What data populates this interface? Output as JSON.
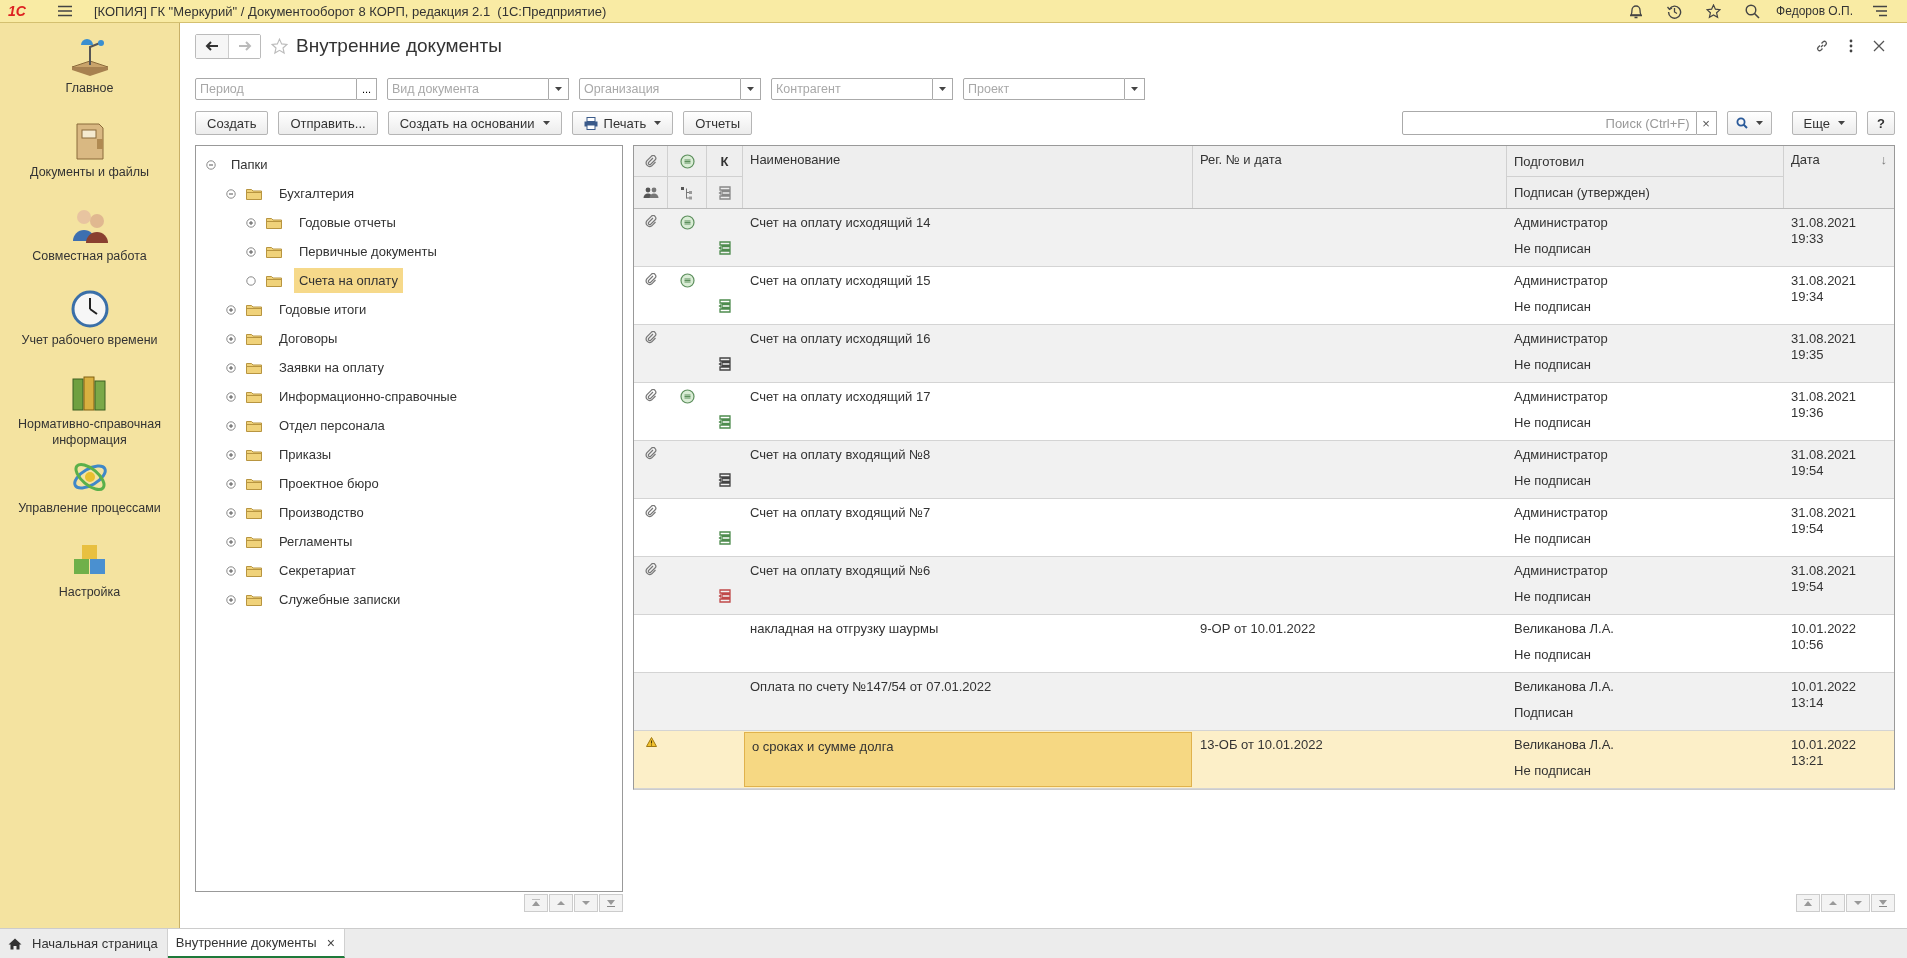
{
  "app": {
    "logo": "1С",
    "title": "[КОПИЯ] ГК \"Меркурий\" / Документооборот 8 КОРП, редакция 2.1  (1С:Предприятие)",
    "user": "Федоров О.П."
  },
  "sidebar": {
    "items": [
      {
        "label": "Главное",
        "kind": "lamp"
      },
      {
        "label": "Документы и файлы",
        "kind": "binder"
      },
      {
        "label": "Совместная работа",
        "kind": "people"
      },
      {
        "label": "Учет рабочего времени",
        "kind": "clock"
      },
      {
        "label": "Нормативно-справочная информация",
        "kind": "books"
      },
      {
        "label": "Управление процессами",
        "kind": "orbit"
      },
      {
        "label": "Настройка",
        "kind": "cubes"
      }
    ]
  },
  "form": {
    "title": "Внутренние документы"
  },
  "filters": [
    {
      "placeholder": "Период",
      "kind": "period",
      "button": "..."
    },
    {
      "placeholder": "Вид документа",
      "kind": "select"
    },
    {
      "placeholder": "Организация",
      "kind": "select"
    },
    {
      "placeholder": "Контрагент",
      "kind": "select"
    },
    {
      "placeholder": "Проект",
      "kind": "select"
    }
  ],
  "toolbar": {
    "buttons": [
      {
        "label": "Создать",
        "kind": "plain"
      },
      {
        "label": "Отправить...",
        "kind": "plain"
      },
      {
        "label": "Создать на основании",
        "kind": "menu"
      },
      {
        "label": "Печать",
        "kind": "print"
      },
      {
        "label": "Отчеты",
        "kind": "plain"
      }
    ],
    "search": {
      "placeholder": "Поиск (Ctrl+F)",
      "clear": "×"
    },
    "more": "Еще",
    "help": "?"
  },
  "tree": [
    {
      "label": "Папки",
      "expanded": true,
      "selected": false,
      "children": [
        {
          "label": "Бухгалтерия",
          "kind": "folder",
          "expanded": true,
          "selected": false,
          "children": [
            {
              "label": "Годовые отчеты",
              "kind": "folder",
              "expanded": false,
              "selected": false
            },
            {
              "label": "Первичные документы",
              "kind": "folder",
              "expanded": false,
              "selected": false
            },
            {
              "label": "Счета на оплату",
              "kind": "leaf",
              "selected": true
            }
          ]
        },
        {
          "label": "Годовые итоги",
          "kind": "folder",
          "expanded": false,
          "selected": false
        },
        {
          "label": "Договоры",
          "kind": "folder",
          "expanded": false,
          "selected": false
        },
        {
          "label": "Заявки на оплату",
          "kind": "folder",
          "expanded": false,
          "selected": false
        },
        {
          "label": "Информационно-справочные",
          "kind": "folder",
          "expanded": false,
          "selected": false
        },
        {
          "label": "Отдел персонала",
          "kind": "folder",
          "expanded": false,
          "selected": false
        },
        {
          "label": "Приказы",
          "kind": "folder",
          "expanded": false,
          "selected": false
        },
        {
          "label": "Проектное бюро",
          "kind": "folder",
          "expanded": false,
          "selected": false
        },
        {
          "label": "Производство",
          "kind": "folder",
          "expanded": false,
          "selected": false
        },
        {
          "label": "Регламенты",
          "kind": "folder",
          "expanded": false,
          "selected": false
        },
        {
          "label": "Секретариат",
          "kind": "folder",
          "expanded": false,
          "selected": false
        },
        {
          "label": "Служебные записки",
          "kind": "folder",
          "expanded": false,
          "selected": false
        }
      ]
    }
  ],
  "table": {
    "columns": {
      "k": "К",
      "name": "Наименование",
      "reg": "Рег. № и дата",
      "prepared": "Подготовил",
      "signed": "Подписан (утвержден)",
      "date": "Дата",
      "sort_mark": "↓"
    },
    "rows": [
      {
        "attachment": true,
        "warning": false,
        "status_mark": true,
        "route": {
          "color": "#4e8c4e"
        },
        "name": "Счет на оплату исходящий 14",
        "prepared": "Администратор",
        "signed": "Не подписан",
        "date": "31.08.2021",
        "time": "19:33",
        "selected": false
      },
      {
        "attachment": true,
        "warning": false,
        "status_mark": true,
        "route": {
          "color": "#4e8c4e"
        },
        "name": "Счет на оплату исходящий 15",
        "prepared": "Администратор",
        "signed": "Не подписан",
        "date": "31.08.2021",
        "time": "19:34",
        "selected": false
      },
      {
        "attachment": true,
        "warning": false,
        "status_mark": false,
        "route": {
          "color": "#444444"
        },
        "name": "Счет на оплату исходящий 16",
        "prepared": "Администратор",
        "signed": "Не подписан",
        "date": "31.08.2021",
        "time": "19:35",
        "selected": false
      },
      {
        "attachment": true,
        "warning": false,
        "status_mark": true,
        "route": {
          "color": "#4e8c4e"
        },
        "name": "Счет на оплату исходящий 17",
        "prepared": "Администратор",
        "signed": "Не подписан",
        "date": "31.08.2021",
        "time": "19:36",
        "selected": false
      },
      {
        "attachment": true,
        "warning": false,
        "status_mark": false,
        "route": {
          "color": "#444444"
        },
        "name": "Счет на оплату входящий №8",
        "prepared": "Администратор",
        "signed": "Не подписан",
        "date": "31.08.2021",
        "time": "19:54",
        "selected": false
      },
      {
        "attachment": true,
        "warning": false,
        "status_mark": false,
        "route": {
          "color": "#4e8c4e"
        },
        "name": "Счет на оплату входящий №7",
        "prepared": "Администратор",
        "signed": "Не подписан",
        "date": "31.08.2021",
        "time": "19:54",
        "selected": false
      },
      {
        "attachment": true,
        "warning": false,
        "status_mark": false,
        "route": {
          "color": "#c04848"
        },
        "name": "Счет на оплату входящий №6",
        "prepared": "Администратор",
        "signed": "Не подписан",
        "date": "31.08.2021",
        "time": "19:54",
        "selected": false
      },
      {
        "attachment": false,
        "warning": false,
        "status_mark": false,
        "name": "накладная на отгрузку шаурмы",
        "reg": "9-ОР от 10.01.2022",
        "prepared": "Великанова Л.А.",
        "signed": "Не подписан",
        "date": "10.01.2022",
        "time": "10:56",
        "selected": false
      },
      {
        "attachment": false,
        "warning": false,
        "status_mark": false,
        "name": "Оплата по счету №147/54 от 07.01.2022",
        "prepared": "Великанова Л.А.",
        "signed": "Подписан",
        "date": "10.01.2022",
        "time": "13:14",
        "selected": false
      },
      {
        "attachment": false,
        "warning": true,
        "status_mark": false,
        "name": "о сроках и сумме долга",
        "reg": "13-ОБ от 10.01.2022",
        "prepared": "Великанова Л.А.",
        "signed": "Не подписан",
        "date": "10.01.2022",
        "time": "13:21",
        "selected": true
      }
    ]
  },
  "tabs": [
    {
      "label": "Начальная страница",
      "kind": "home",
      "selected": false
    },
    {
      "label": "Внутренние документы",
      "kind": "document",
      "close": "×",
      "selected": true
    }
  ]
}
